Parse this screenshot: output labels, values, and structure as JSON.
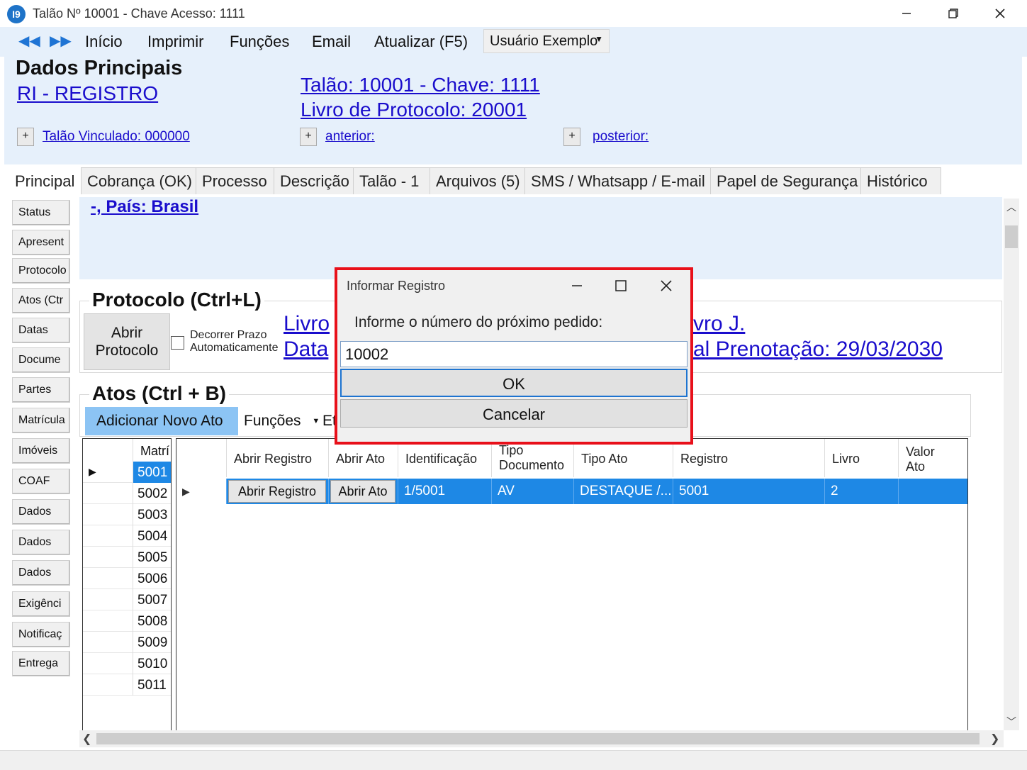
{
  "window": {
    "logo_text": "I9",
    "title": "Talão Nº 10001 - Chave Acesso: 1111"
  },
  "menu": {
    "items": [
      "Início",
      "Imprimir",
      "Funções",
      "Email",
      "Atualizar (F5)"
    ],
    "user": "Usuário Exemplo"
  },
  "header": {
    "title": "Dados Principais",
    "type_link": "RI - REGISTRO",
    "talao_link": "Talão: 10001 -  Chave: 1111",
    "livro_link": "Livro de Protocolo: 20001",
    "vinculado_link": "Talão Vinculado: 000000",
    "anterior_link": "anterior:",
    "posterior_link": "posterior:",
    "plus": "+"
  },
  "tabs": [
    "Principal",
    "Cobrança (OK)",
    "Processo",
    "Descrição",
    "Talão - 1",
    "Arquivos (5)",
    "SMS / Whatsapp / E-mail",
    "Papel de Segurança",
    "Histórico"
  ],
  "side_buttons": [
    "Status",
    "Apresent",
    "Protocolo",
    "Atos (Ctr",
    "Datas",
    "Docume",
    "Partes",
    "Matrícula",
    "Imóveis",
    "COAF",
    "Dados",
    "Dados",
    "Dados",
    "Exigênci",
    "Notificaç",
    "Entrega"
  ],
  "content": {
    "pais_link": "-, País: Brasil",
    "protocolo_title": "Protocolo  (Ctrl+L)",
    "abrir_protocolo": "Abrir Protocolo",
    "decorrer_label": "Decorrer Prazo Automaticamente",
    "livro_link_partial": "Livro",
    "data_link_partial": "Data",
    "livro_j_partial": "vro J.",
    "prenotacao_partial": "al Prenotação: 29/03/2030",
    "atos_title": "Atos (Ctrl + B)",
    "add_ato": "Adicionar Novo Ato",
    "funcoes": "Funções",
    "et_partial": "Et"
  },
  "matricula_grid": {
    "header": "Matrí",
    "rows": [
      "5001",
      "5002",
      "5003",
      "5004",
      "5005",
      "5006",
      "5007",
      "5008",
      "5009",
      "5010",
      "5011"
    ]
  },
  "atos_grid": {
    "headers": [
      "Abrir Registro",
      "Abrir Ato",
      "Identificação",
      "Tipo Documento",
      "Tipo Ato",
      "Registro",
      "Livro",
      "Valor Ato"
    ],
    "row": {
      "abrir_registro": "Abrir Registro",
      "abrir_ato": "Abrir Ato",
      "identificacao": "1/5001",
      "tipo_documento": "AV",
      "tipo_ato": "DESTAQUE /...",
      "registro": "5001",
      "livro": "2",
      "valor_ato": ""
    }
  },
  "dialog": {
    "title": "Informar Registro",
    "prompt": "Informe o número do próximo pedido:",
    "input_value": "10002",
    "ok": "OK",
    "cancel": "Cancelar"
  },
  "colors": {
    "accent": "#1e88e5",
    "header_bg": "#e6f0fb",
    "link": "#1a0dcc",
    "dialog_highlight": "#e8101a"
  }
}
